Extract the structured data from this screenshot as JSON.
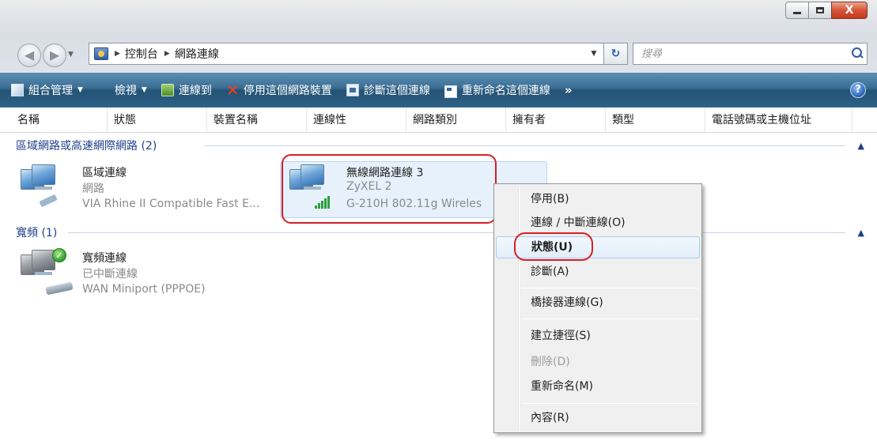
{
  "window": {
    "controls": {
      "minimize": "—",
      "maximize": "□",
      "close": "X"
    }
  },
  "nav": {
    "back_glyph": "◀",
    "forward_glyph": "▶",
    "breadcrumb": [
      "控制台",
      "網路連線"
    ],
    "search_placeholder": "搜尋"
  },
  "commandbar": {
    "items": [
      {
        "label": "組合管理",
        "icon": "organize-icon",
        "dropdown": true
      },
      {
        "label": "檢視",
        "icon": "views-icon",
        "dropdown": true
      },
      {
        "label": "連線到",
        "icon": "connect-icon",
        "dropdown": false
      },
      {
        "label": "停用這個網路裝置",
        "icon": "disable-x-icon",
        "dropdown": false
      },
      {
        "label": "診斷這個連線",
        "icon": "diagnose-icon",
        "dropdown": false
      },
      {
        "label": "重新命名這個連線",
        "icon": "rename-icon",
        "dropdown": false
      }
    ],
    "more": "»",
    "help": "?"
  },
  "columns": [
    "名稱",
    "狀態",
    "裝置名稱",
    "連線性",
    "網路類別",
    "擁有者",
    "類型",
    "電話號碼或主機位址"
  ],
  "groups": [
    {
      "title": "區域網路或高速網際網路 (2)",
      "collapse": "▲"
    },
    {
      "title": "寬頻 (1)",
      "collapse": "▲"
    }
  ],
  "connections": {
    "lan": {
      "name": "區域連線",
      "status": "網路",
      "device": "VIA Rhine II Compatible Fast E..."
    },
    "wireless": {
      "name": "無線網路連線 3",
      "status": "ZyXEL  2",
      "device": "G-210H 802.11g Wireles"
    },
    "broadband": {
      "name": "寬頻連線",
      "status": "已中斷連線",
      "device": "WAN Miniport (PPPOE)"
    }
  },
  "context_menu": {
    "items": [
      {
        "label": "停用(B)",
        "state": "normal"
      },
      {
        "label": "連線 / 中斷連線(O)",
        "state": "normal"
      },
      {
        "label": "狀態(U)",
        "state": "highlighted"
      },
      {
        "label": "診斷(A)",
        "state": "normal"
      },
      {
        "label": "橋接器連線(G)",
        "state": "normal"
      },
      {
        "label": "建立捷徑(S)",
        "state": "normal"
      },
      {
        "label": "刪除(D)",
        "state": "disabled"
      },
      {
        "label": "重新命名(M)",
        "state": "normal"
      },
      {
        "label": "內容(R)",
        "state": "normal"
      }
    ]
  },
  "colors": {
    "annotation_ring": "#d61f26",
    "command_bar": "#2f6288",
    "group_header": "#1e3f8c",
    "selection": "#e7f1fc"
  }
}
